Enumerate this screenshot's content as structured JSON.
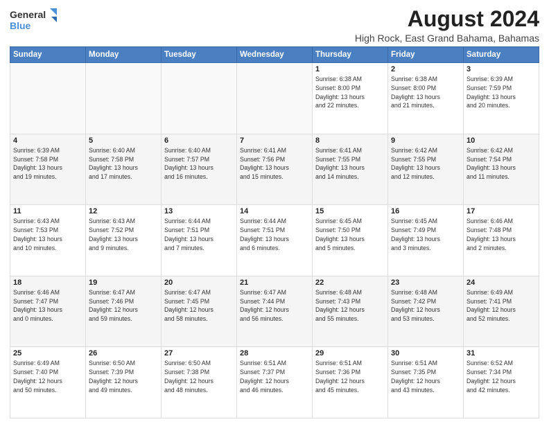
{
  "header": {
    "logo_line1": "General",
    "logo_line2": "Blue",
    "main_title": "August 2024",
    "subtitle": "High Rock, East Grand Bahama, Bahamas"
  },
  "days_of_week": [
    "Sunday",
    "Monday",
    "Tuesday",
    "Wednesday",
    "Thursday",
    "Friday",
    "Saturday"
  ],
  "weeks": [
    [
      {
        "day": "",
        "info": ""
      },
      {
        "day": "",
        "info": ""
      },
      {
        "day": "",
        "info": ""
      },
      {
        "day": "",
        "info": ""
      },
      {
        "day": "1",
        "info": "Sunrise: 6:38 AM\nSunset: 8:00 PM\nDaylight: 13 hours\nand 22 minutes."
      },
      {
        "day": "2",
        "info": "Sunrise: 6:38 AM\nSunset: 8:00 PM\nDaylight: 13 hours\nand 21 minutes."
      },
      {
        "day": "3",
        "info": "Sunrise: 6:39 AM\nSunset: 7:59 PM\nDaylight: 13 hours\nand 20 minutes."
      }
    ],
    [
      {
        "day": "4",
        "info": "Sunrise: 6:39 AM\nSunset: 7:58 PM\nDaylight: 13 hours\nand 19 minutes."
      },
      {
        "day": "5",
        "info": "Sunrise: 6:40 AM\nSunset: 7:58 PM\nDaylight: 13 hours\nand 17 minutes."
      },
      {
        "day": "6",
        "info": "Sunrise: 6:40 AM\nSunset: 7:57 PM\nDaylight: 13 hours\nand 16 minutes."
      },
      {
        "day": "7",
        "info": "Sunrise: 6:41 AM\nSunset: 7:56 PM\nDaylight: 13 hours\nand 15 minutes."
      },
      {
        "day": "8",
        "info": "Sunrise: 6:41 AM\nSunset: 7:55 PM\nDaylight: 13 hours\nand 14 minutes."
      },
      {
        "day": "9",
        "info": "Sunrise: 6:42 AM\nSunset: 7:55 PM\nDaylight: 13 hours\nand 12 minutes."
      },
      {
        "day": "10",
        "info": "Sunrise: 6:42 AM\nSunset: 7:54 PM\nDaylight: 13 hours\nand 11 minutes."
      }
    ],
    [
      {
        "day": "11",
        "info": "Sunrise: 6:43 AM\nSunset: 7:53 PM\nDaylight: 13 hours\nand 10 minutes."
      },
      {
        "day": "12",
        "info": "Sunrise: 6:43 AM\nSunset: 7:52 PM\nDaylight: 13 hours\nand 9 minutes."
      },
      {
        "day": "13",
        "info": "Sunrise: 6:44 AM\nSunset: 7:51 PM\nDaylight: 13 hours\nand 7 minutes."
      },
      {
        "day": "14",
        "info": "Sunrise: 6:44 AM\nSunset: 7:51 PM\nDaylight: 13 hours\nand 6 minutes."
      },
      {
        "day": "15",
        "info": "Sunrise: 6:45 AM\nSunset: 7:50 PM\nDaylight: 13 hours\nand 5 minutes."
      },
      {
        "day": "16",
        "info": "Sunrise: 6:45 AM\nSunset: 7:49 PM\nDaylight: 13 hours\nand 3 minutes."
      },
      {
        "day": "17",
        "info": "Sunrise: 6:46 AM\nSunset: 7:48 PM\nDaylight: 13 hours\nand 2 minutes."
      }
    ],
    [
      {
        "day": "18",
        "info": "Sunrise: 6:46 AM\nSunset: 7:47 PM\nDaylight: 13 hours\nand 0 minutes."
      },
      {
        "day": "19",
        "info": "Sunrise: 6:47 AM\nSunset: 7:46 PM\nDaylight: 12 hours\nand 59 minutes."
      },
      {
        "day": "20",
        "info": "Sunrise: 6:47 AM\nSunset: 7:45 PM\nDaylight: 12 hours\nand 58 minutes."
      },
      {
        "day": "21",
        "info": "Sunrise: 6:47 AM\nSunset: 7:44 PM\nDaylight: 12 hours\nand 56 minutes."
      },
      {
        "day": "22",
        "info": "Sunrise: 6:48 AM\nSunset: 7:43 PM\nDaylight: 12 hours\nand 55 minutes."
      },
      {
        "day": "23",
        "info": "Sunrise: 6:48 AM\nSunset: 7:42 PM\nDaylight: 12 hours\nand 53 minutes."
      },
      {
        "day": "24",
        "info": "Sunrise: 6:49 AM\nSunset: 7:41 PM\nDaylight: 12 hours\nand 52 minutes."
      }
    ],
    [
      {
        "day": "25",
        "info": "Sunrise: 6:49 AM\nSunset: 7:40 PM\nDaylight: 12 hours\nand 50 minutes."
      },
      {
        "day": "26",
        "info": "Sunrise: 6:50 AM\nSunset: 7:39 PM\nDaylight: 12 hours\nand 49 minutes."
      },
      {
        "day": "27",
        "info": "Sunrise: 6:50 AM\nSunset: 7:38 PM\nDaylight: 12 hours\nand 48 minutes."
      },
      {
        "day": "28",
        "info": "Sunrise: 6:51 AM\nSunset: 7:37 PM\nDaylight: 12 hours\nand 46 minutes."
      },
      {
        "day": "29",
        "info": "Sunrise: 6:51 AM\nSunset: 7:36 PM\nDaylight: 12 hours\nand 45 minutes."
      },
      {
        "day": "30",
        "info": "Sunrise: 6:51 AM\nSunset: 7:35 PM\nDaylight: 12 hours\nand 43 minutes."
      },
      {
        "day": "31",
        "info": "Sunrise: 6:52 AM\nSunset: 7:34 PM\nDaylight: 12 hours\nand 42 minutes."
      }
    ]
  ]
}
